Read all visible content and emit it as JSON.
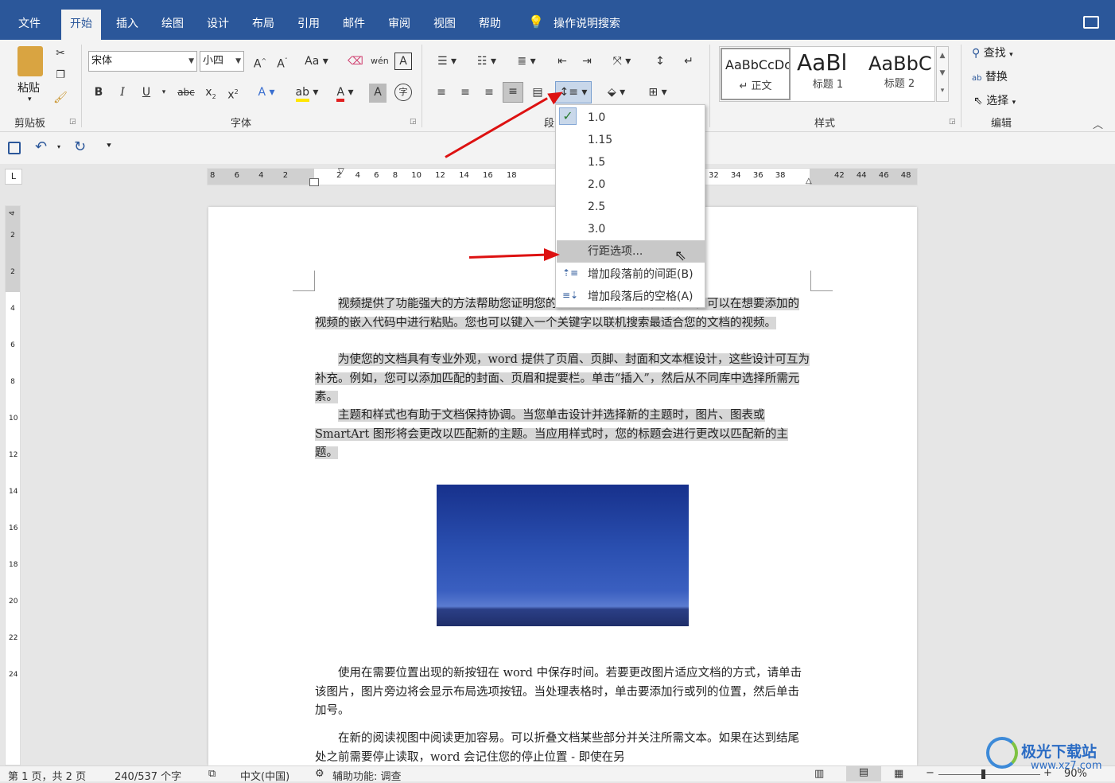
{
  "menu_tabs": [
    "文件",
    "开始",
    "插入",
    "绘图",
    "设计",
    "布局",
    "引用",
    "邮件",
    "审阅",
    "视图",
    "帮助"
  ],
  "tell_me": "操作说明搜索",
  "clipboard": {
    "paste": "粘贴",
    "label": "剪贴板"
  },
  "font": {
    "name": "宋体",
    "size": "小四",
    "label": "字体"
  },
  "paragraph": {
    "label": "段"
  },
  "styles": {
    "label": "样式",
    "items": [
      {
        "preview": "AaBbCcDc",
        "name": "↵ 正文"
      },
      {
        "preview": "AaBl",
        "name": "标题 1"
      },
      {
        "preview": "AaBbC",
        "name": "标题 2"
      }
    ]
  },
  "editing": {
    "label": "编辑",
    "find": "查找",
    "replace": "替换",
    "select": "选择"
  },
  "line_spacing_menu": {
    "options": [
      "1.0",
      "1.15",
      "1.5",
      "2.0",
      "2.5",
      "3.0"
    ],
    "selected": "1.0",
    "line_spacing_options": "行距选项...",
    "add_before": "增加段落前的间距(B)",
    "add_after": "增加段落后的空格(A)"
  },
  "ruler": {
    "left_ticks": [
      "8",
      "6",
      "4",
      "2"
    ],
    "right_ticks": [
      "2",
      "4",
      "6",
      "8",
      "10",
      "12",
      "14",
      "16",
      "18"
    ],
    "far_ticks": [
      "32",
      "34",
      "36",
      "38"
    ],
    "margin_ticks": [
      "42",
      "44",
      "46",
      "48"
    ]
  },
  "vruler_ticks": [
    "4",
    "2",
    "2",
    "4",
    "6",
    "8",
    "10",
    "12",
    "14",
    "16",
    "18",
    "20",
    "22",
    "24"
  ],
  "document": {
    "p1": "视频提供了功能强大的方法帮助您证明您的观点。当您单击联机视频时，可以在想要添加的视频的嵌入代码中进行粘贴。您也可以键入一个关键字以联机搜索最适合您的文档的视频。",
    "p2": "为使您的文档具有专业外观，word 提供了页眉、页脚、封面和文本框设计，这些设计可互为补充。例如，您可以添加匹配的封面、页眉和提要栏。单击“插入”，然后从不同库中选择所需元素。",
    "p3": "主题和样式也有助于文档保持协调。当您单击设计并选择新的主题时，图片、图表或 SmartArt 图形将会更改以匹配新的主题。当应用样式时，您的标题会进行更改以匹配新的主题。",
    "p4": "使用在需要位置出现的新按钮在 word 中保存时间。若要更改图片适应文档的方式，请单击该图片，图片旁边将会显示布局选项按钮。当处理表格时，单击要添加行或列的位置，然后单击加号。",
    "p5": "在新的阅读视图中阅读更加容易。可以折叠文档某些部分并关注所需文本。如果在达到结尾处之前需要停止读取，word 会记住您的停止位置 - 即使在另"
  },
  "status": {
    "page": "第 1 页，共 2 页",
    "words": "240/537 个字",
    "language": "中文(中国)",
    "accessibility": "辅助功能: 调查",
    "zoom": "90%"
  },
  "watermark": {
    "name": "极光下载站",
    "url": "www.xz7.com"
  }
}
